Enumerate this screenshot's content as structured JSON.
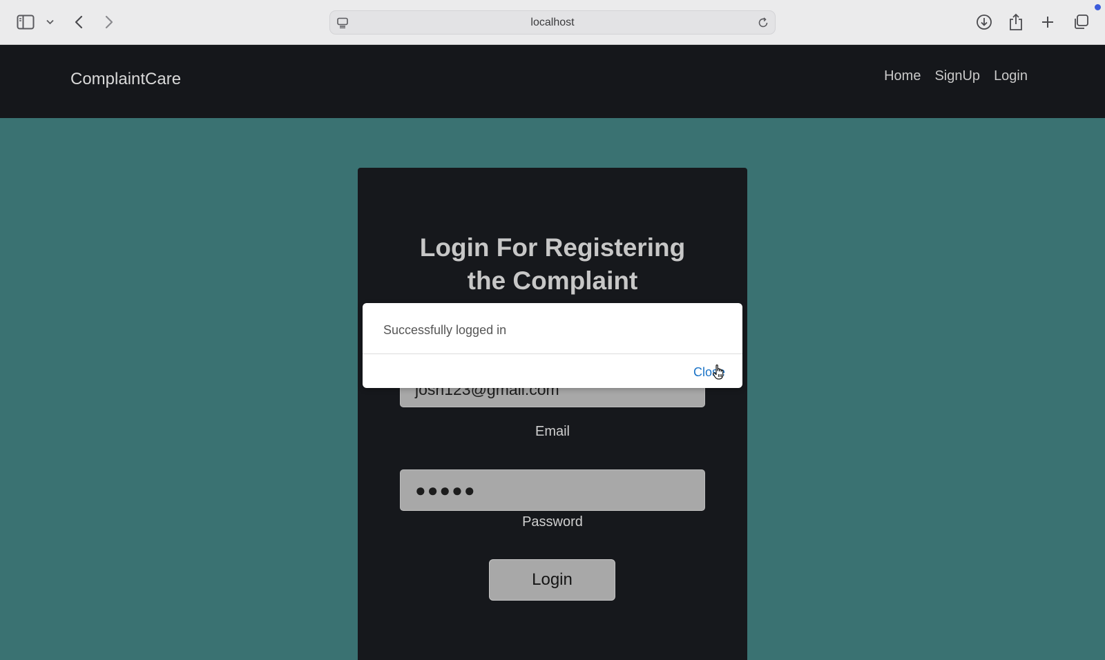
{
  "browser": {
    "url": "localhost",
    "icons": [
      "sidebar-icon",
      "chevron-down-icon",
      "back-icon",
      "forward-icon",
      "site-icon",
      "reload-icon",
      "download-icon",
      "share-icon",
      "plus-icon",
      "tabs-icon"
    ]
  },
  "navbar": {
    "brand": "ComplaintCare",
    "links": [
      "Home",
      "SignUp",
      "Login"
    ]
  },
  "card": {
    "title_line1": "Login For Registering",
    "title_line2": "the Complaint",
    "email_value": "josh123@gmail.com",
    "email_label": "Email",
    "password_value": "●●●●●",
    "password_label": "Password",
    "login_button": "Login"
  },
  "modal": {
    "message": "Successfully logged in",
    "close_label": "Close"
  },
  "colors": {
    "page_bg": "#3a7272",
    "navbar_bg": "#15171b",
    "card_bg": "#16181c",
    "link_blue": "#1a73c7"
  }
}
